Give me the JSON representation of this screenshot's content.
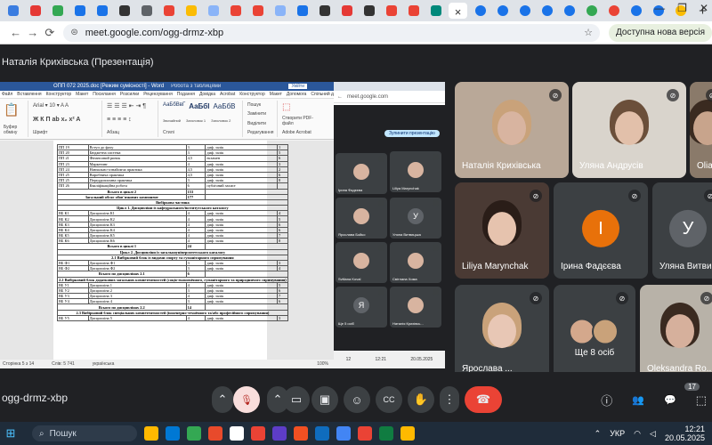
{
  "browser": {
    "tab_colors": [
      "#3b7de0",
      "#e53935",
      "#34a853",
      "#1a73e8",
      "#1a73e8",
      "#333333",
      "#5f6368",
      "#ea4335",
      "#fbbc04",
      "#8ab4f8",
      "#ea4335",
      "#ea4335",
      "#8ab4f8",
      "#1a73e8",
      "#333333",
      "#e53935",
      "#333333",
      "#ea4335",
      "#ea4335",
      "#00897b"
    ],
    "active_tab_close": "×",
    "right_tab_colors": [
      "#1a73e8",
      "#1a73e8",
      "#1a73e8",
      "#1a73e8",
      "#1a73e8",
      "#34a853",
      "#ea4335",
      "#1a73e8",
      "#1a73e8",
      "#fbbc04"
    ],
    "new_tab": "+",
    "window_controls": [
      "—",
      "❐",
      "✕"
    ],
    "back": "←",
    "forward": "→",
    "reload": "⟳",
    "url": "meet.google.com/ogg-drmz-xbp",
    "update_label": "Доступна нова версія"
  },
  "presenter_bar": {
    "title": "Наталія Крихівська (Презентація)"
  },
  "word": {
    "title": "ОПП 072 2025.doc [Режим сумісності] - Word",
    "subtitle": "Робота з таблицями",
    "user": "Увійти",
    "menu": [
      "Файл",
      "Вставлення",
      "Конструктор",
      "Макет",
      "Посилання",
      "Розсилки",
      "Рецензування",
      "Подання",
      "Довідка",
      "Acrobat",
      "Конструктор",
      "Макет",
      "Допомога",
      "Спільний доступ"
    ],
    "groups": [
      "Буфер обміну",
      "Шрифт",
      "Абзац",
      "Стилі",
      "Редагування",
      "Adobe Acrobat"
    ],
    "styles": [
      "АаБбВвГ",
      "АаБбІ",
      "АаБбВ"
    ],
    "style_names": [
      "Звичайний",
      "Заголовок 1",
      "Заголовок 2"
    ],
    "edit_items": [
      "Пошук",
      "Замінити",
      "Виділити"
    ],
    "acrobat_label": "Створити PDF-файл",
    "rows": [
      [
        "ПП 19",
        "Вступ до фаху",
        "3",
        "диф. залік",
        "1"
      ],
      [
        "ПП 20",
        "Бюджетна система",
        "3",
        "диф. залік",
        "5"
      ],
      [
        "ПП 21",
        "Фінансовий ринок",
        "4,5",
        "екзамен",
        "6"
      ],
      [
        "ПП 23",
        "Маркетинг",
        "4",
        "диф. залік",
        "3"
      ],
      [
        "ПП 24",
        "Навчально-ознайомча практика",
        "4,5",
        "диф. залік",
        "2"
      ],
      [
        "ПП 25",
        "Виробнича практика",
        "4,5",
        "диф. залік",
        "6"
      ],
      [
        "ПП 25",
        "Переддипломна практика",
        "3",
        "диф. залік",
        "8"
      ],
      [
        "ПП 26",
        "Кваліфікаційна робота",
        "6",
        "публічний захист",
        ""
      ]
    ],
    "totals": [
      [
        "Всього в циклі 2",
        "153"
      ],
      [
        "Загальний обсяг обов'язкових компонент",
        "177"
      ]
    ],
    "section_optional": "Вибіркова частина",
    "cycle1": "Цикл 1. Дисципліни із кафедрального/інститутського каталогу",
    "vk_rows": [
      [
        "ВБ К1",
        "Дисципліна К1",
        "4",
        "диф. залік",
        "4"
      ],
      [
        "ВБ К2",
        "Дисципліна К2",
        "4",
        "диф. залік",
        "5"
      ],
      [
        "ВБ К3",
        "Дисципліна К3",
        "4",
        "диф. залік",
        "6"
      ],
      [
        "ВБ К4",
        "Дисципліна К4",
        "4",
        "диф. залік",
        "6"
      ],
      [
        "ВБ К5",
        "Дисципліна К5",
        "4",
        "диф. залік",
        "7"
      ],
      [
        "ВБ К6",
        "Дисципліна К6",
        "4",
        "диф. залік",
        "8"
      ]
    ],
    "cycle1_total": [
      "Всього в циклі 1",
      "24"
    ],
    "cycle2": "Цикл 2. Дисципліни із загальноуніверситетського каталогу",
    "block21": "2.1 Вибірковий блок із видами спорту та гуманітарного спрямування",
    "vf_rows": [
      [
        "ВБ Ф1",
        "Дисципліна Ф1",
        "3",
        "диф. залік",
        "3"
      ],
      [
        "ВБ Ф2",
        "Дисципліна Ф2",
        "3",
        "диф. залік",
        "4"
      ]
    ],
    "total21": [
      "Всього по дисциплінах 2.1",
      "6"
    ],
    "block22": "2.2 Вибірковий блок додаткових загальних компетентностей (соціо-економічного, гуманітарного та природничого спрямування)",
    "vu_rows": [
      [
        "ВБ У1",
        "Дисципліна 1",
        "4",
        "диф. залік",
        "5"
      ],
      [
        "ВБ У2",
        "Дисципліна 2",
        "3",
        "диф. залік",
        "6"
      ],
      [
        "ВБ У3",
        "Дисципліна 3",
        "4",
        "диф. залік",
        "7"
      ],
      [
        "ВБ У4",
        "Дисципліна 4",
        "3",
        "диф. залік",
        "6"
      ]
    ],
    "total22": [
      "Всього по дисциплінах 2.2",
      "14"
    ],
    "block23": "2.3 Вибірковий блок спеціальних компетентностей (інженерно-технічного та/або професійного спрямування)",
    "vz_rows": [
      [
        "ВБ У5",
        "Дисципліна 5",
        "4",
        "диф. залік",
        "3"
      ]
    ],
    "status": [
      "Сторінка 5 з 14",
      "Слів: 5 741",
      "українська"
    ],
    "zoom": "100%"
  },
  "mini_meet": {
    "address": "meet.google.com",
    "stop_label": "Зупинити презентацію",
    "tiles": [
      {
        "name": "Ірина Фадєєва",
        "letter": "",
        "color": "#5f6368"
      },
      {
        "name": "Liliya Marynchak",
        "letter": "",
        "color": "#5f6368"
      },
      {
        "name": "Ярослава Бойко",
        "letter": "",
        "color": "#5f6368"
      },
      {
        "name": "Уляна Витвицька",
        "letter": "У",
        "color": "#5f6368"
      },
      {
        "name": "Svitlana Koval",
        "letter": "",
        "color": "#5f6368"
      },
      {
        "name": "Світлана Хома",
        "letter": "",
        "color": "#5f6368"
      },
      {
        "name": "Ще 5 осіб",
        "letter": "Я",
        "color": "#5f6368"
      },
      {
        "name": "Наталія Крихівсь...",
        "letter": "",
        "color": "#5f6368"
      }
    ],
    "count": "12",
    "time": "12:21",
    "date": "20.05.2025"
  },
  "participants": [
    {
      "name": "Наталія Крихівська",
      "type": "video",
      "skin": "#d8b4a0",
      "hair": "#c9a27a",
      "bg": "#b9a898"
    },
    {
      "name": "Уляна Андрусів",
      "type": "video",
      "skin": "#e2c0aa",
      "hair": "#6b4f3a",
      "bg": "#d9d4cc"
    },
    {
      "name": "Olia",
      "type": "video",
      "skin": "#c8a48c",
      "hair": "#3a2a20",
      "bg": "#8a7a6a"
    },
    {
      "name": "Liliya Marynchak",
      "type": "video",
      "skin": "#e6c3ae",
      "hair": "#2a1d18",
      "bg": "#4a3a34"
    },
    {
      "name": "Ірина Фадєєва",
      "type": "letter",
      "letter": "І",
      "color": "#e8710a"
    },
    {
      "name": "Уляна Витвицька",
      "type": "letter",
      "letter": "У",
      "color": "#5f6368"
    },
    {
      "name": "Ярослава ...",
      "type": "photo",
      "skin": "#e8c7b5",
      "hair": "#c9a27a",
      "bg": "#3c4043"
    },
    {
      "name": "Ще 8 осіб",
      "type": "group"
    },
    {
      "name": "Oleksandra Ro...",
      "type": "video",
      "skin": "#d6b09c",
      "hair": "#3a2a20",
      "bg": "#b8b2a8"
    }
  ],
  "controls": {
    "meet_code": "ogg-drmz-xbp",
    "chevron": "⌃",
    "mic": "🎙",
    "cam": "▭",
    "present": "▣",
    "emoji": "☺",
    "cc": "CC",
    "hand": "✋",
    "more": "⋮",
    "end": "☎",
    "info": "ⓘ",
    "people": "👥",
    "chat": "💬",
    "activities": "⬚",
    "people_count": "17"
  },
  "taskbar": {
    "search_placeholder": "Пошук",
    "app_colors": [
      "#ffb900",
      "#0078d4",
      "#34a853",
      "#e84a2b",
      "#ffffff",
      "#ea4335",
      "#5d3dc8",
      "#f25022",
      "#0f6cbd",
      "#4285f4",
      "#ea4335",
      "#107c41",
      "#ffb900"
    ],
    "lang": "УКР",
    "time": "12:21",
    "date": "20.05.2025"
  }
}
